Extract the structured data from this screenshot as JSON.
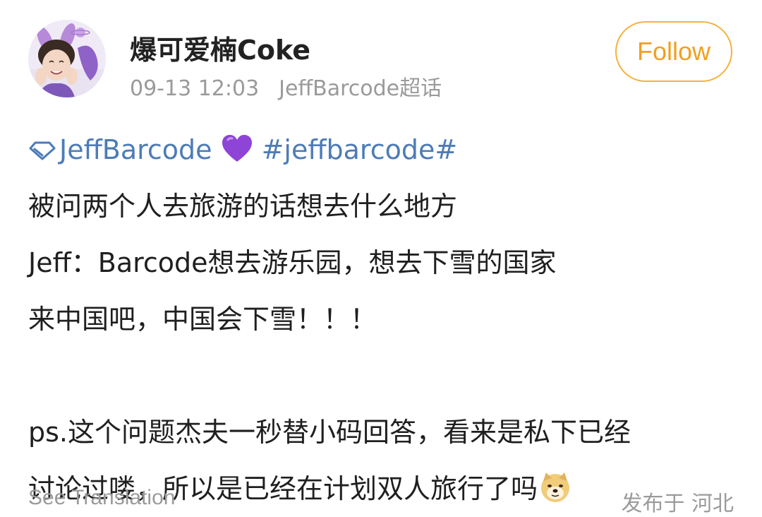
{
  "post": {
    "author": {
      "name": "爆可爱楠Coke",
      "avatar_icon": "profile-avatar"
    },
    "meta": {
      "time": "09-13 12:03",
      "source": "JeffBarcode超话"
    },
    "follow_label": "Follow",
    "content": {
      "tag_line": {
        "diamond_icon": "super-topic-diamond-icon",
        "super_topic": "JeffBarcode",
        "heart_icon": "purple-heart-emoji",
        "hashtag": "#jeffbarcode#"
      },
      "lines": [
        "被问两个人去旅游的话想去什么地方",
        "Jeff：Barcode想去游乐园，想去下雪的国家",
        "来中国吧，中国会下雪！！！",
        "ps.这个问题杰夫一秒替小码回答，看来是私下已经",
        "讨论过喽，所以是已经在计划双人旅行了吗"
      ],
      "end_emoji": "doge-emoji"
    },
    "footer": {
      "translation_label": "See Translation",
      "location": "发布于 河北"
    }
  },
  "colors": {
    "link": "#4d7cb7",
    "follow_accent": "#f0a020",
    "meta_gray": "#9a9a9a",
    "heart_purple": "#8e44d6"
  }
}
